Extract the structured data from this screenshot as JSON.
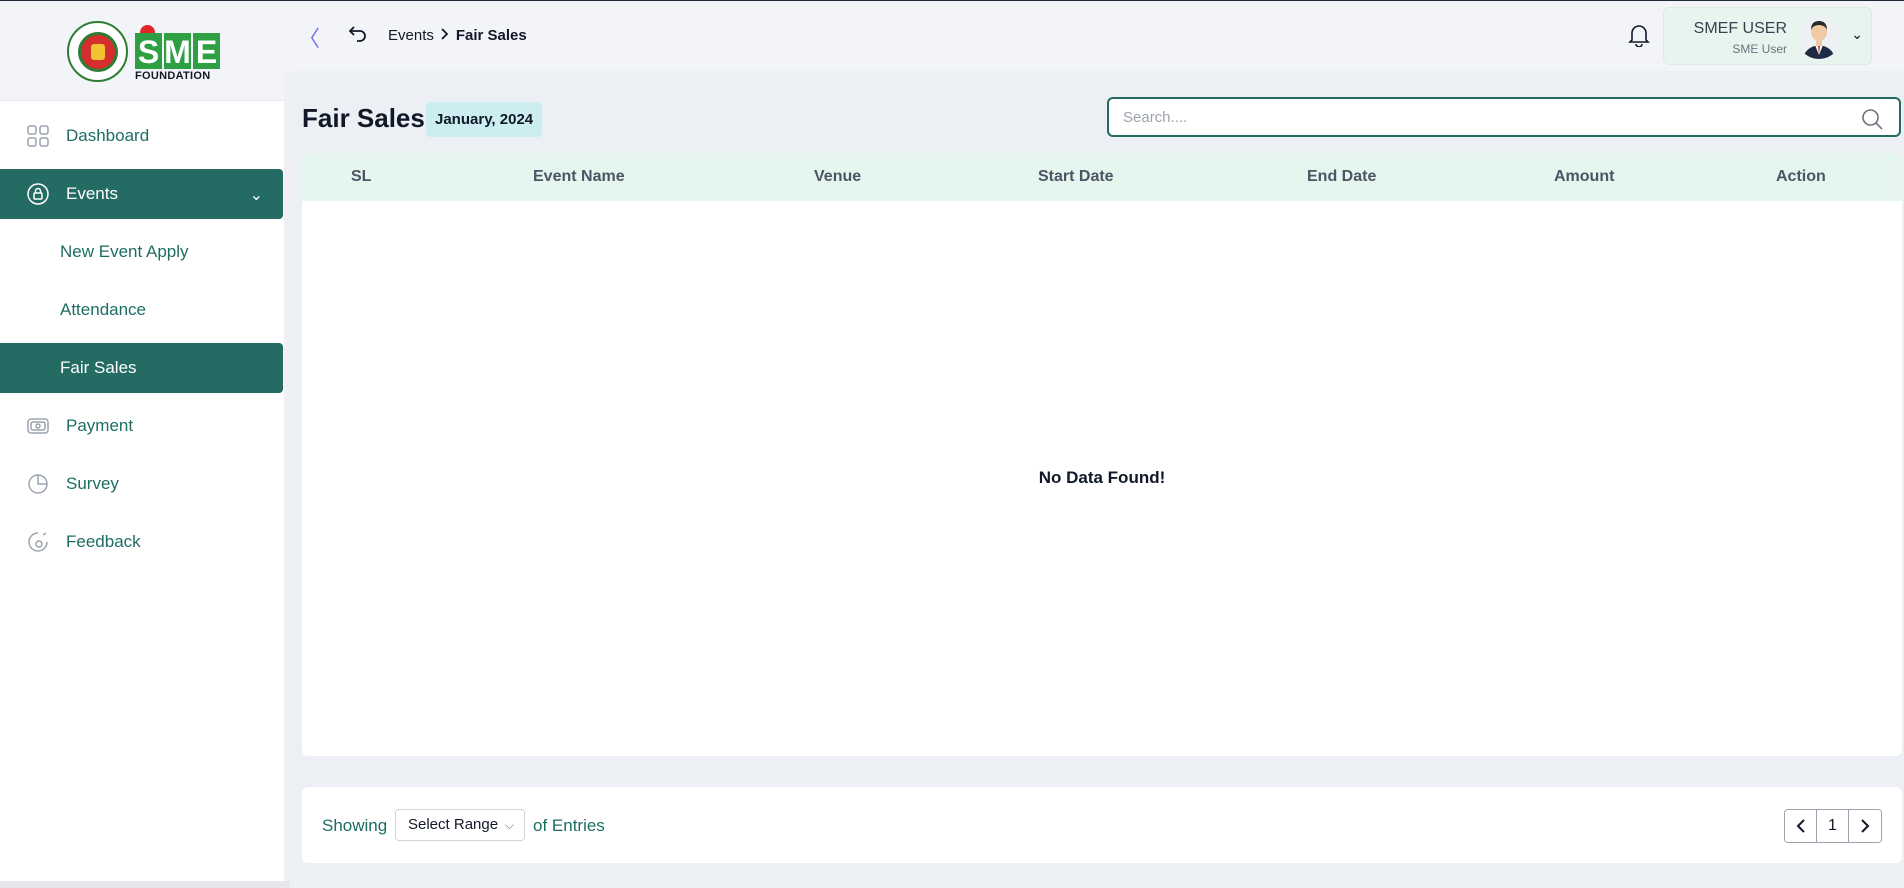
{
  "logo": {
    "org": "SME",
    "subtitle": "FOUNDATION"
  },
  "sidebar": {
    "items": [
      {
        "label": "Dashboard",
        "icon": "grid-icon"
      },
      {
        "label": "Events",
        "icon": "lock-circle-icon",
        "expanded": true,
        "children": [
          {
            "label": "New Event Apply"
          },
          {
            "label": "Attendance"
          },
          {
            "label": "Fair Sales",
            "active": true
          }
        ]
      },
      {
        "label": "Payment",
        "icon": "payment-icon"
      },
      {
        "label": "Survey",
        "icon": "pie-chart-icon"
      },
      {
        "label": "Feedback",
        "icon": "feedback-icon"
      }
    ]
  },
  "topbar": {
    "breadcrumb": [
      "Events",
      "Fair Sales"
    ],
    "user": {
      "name": "SMEF USER",
      "role": "SME User"
    }
  },
  "page": {
    "title": "Fair Sales",
    "period": "January, 2024",
    "search_placeholder": "Search...."
  },
  "table": {
    "columns": [
      "SL",
      "Event Name",
      "Venue",
      "Start Date",
      "End Date",
      "Amount",
      "Action"
    ],
    "rows": [],
    "empty_message": "No Data Found!"
  },
  "footer": {
    "showing": "Showing",
    "range_select": "Select Range",
    "of_entries": "of Entries",
    "page": "1"
  },
  "colors": {
    "primary": "#236b63",
    "header_bg": "#e4f6ee",
    "badge_bg": "#cdeef0",
    "accent_red": "#e3262b",
    "brand_green": "#2ea043"
  }
}
